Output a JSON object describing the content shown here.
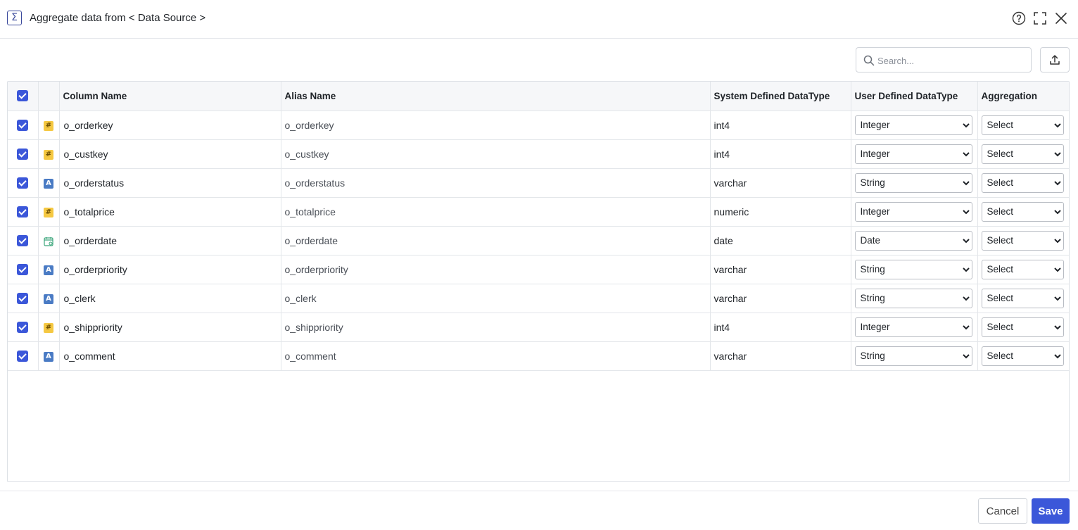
{
  "header": {
    "title": "Aggregate data from < Data Source >",
    "icon": "sigma-icon"
  },
  "toolbar": {
    "search_placeholder": "Search...",
    "search_value": ""
  },
  "table": {
    "headers": {
      "column_name": "Column Name",
      "alias_name": "Alias Name",
      "system_type": "System Defined DataType",
      "user_type": "User Defined DataType",
      "aggregation": "Aggregation"
    },
    "rows": [
      {
        "checked": true,
        "type_icon": "number-icon",
        "name": "o_orderkey",
        "alias": "o_orderkey",
        "system_type": "int4",
        "user_type": "Integer",
        "aggregation": "Select"
      },
      {
        "checked": true,
        "type_icon": "number-icon",
        "name": "o_custkey",
        "alias": "o_custkey",
        "system_type": "int4",
        "user_type": "Integer",
        "aggregation": "Select"
      },
      {
        "checked": true,
        "type_icon": "string-icon",
        "name": "o_orderstatus",
        "alias": "o_orderstatus",
        "system_type": "varchar",
        "user_type": "String",
        "aggregation": "Select"
      },
      {
        "checked": true,
        "type_icon": "number-icon",
        "name": "o_totalprice",
        "alias": "o_totalprice",
        "system_type": "numeric",
        "user_type": "Integer",
        "aggregation": "Select"
      },
      {
        "checked": true,
        "type_icon": "date-icon",
        "name": "o_orderdate",
        "alias": "o_orderdate",
        "system_type": "date",
        "user_type": "Date",
        "aggregation": "Select"
      },
      {
        "checked": true,
        "type_icon": "string-icon",
        "name": "o_orderpriority",
        "alias": "o_orderpriority",
        "system_type": "varchar",
        "user_type": "String",
        "aggregation": "Select"
      },
      {
        "checked": true,
        "type_icon": "string-icon",
        "name": "o_clerk",
        "alias": "o_clerk",
        "system_type": "varchar",
        "user_type": "String",
        "aggregation": "Select"
      },
      {
        "checked": true,
        "type_icon": "number-icon",
        "name": "o_shippriority",
        "alias": "o_shippriority",
        "system_type": "int4",
        "user_type": "Integer",
        "aggregation": "Select"
      },
      {
        "checked": true,
        "type_icon": "string-icon",
        "name": "o_comment",
        "alias": "o_comment",
        "system_type": "varchar",
        "user_type": "String",
        "aggregation": "Select"
      }
    ]
  },
  "footer": {
    "cancel_label": "Cancel",
    "save_label": "Save"
  },
  "colors": {
    "accent": "#3b57d9",
    "number_icon": "#f5c842",
    "string_icon": "#4a7bc4",
    "date_icon": "#3aa57a"
  }
}
